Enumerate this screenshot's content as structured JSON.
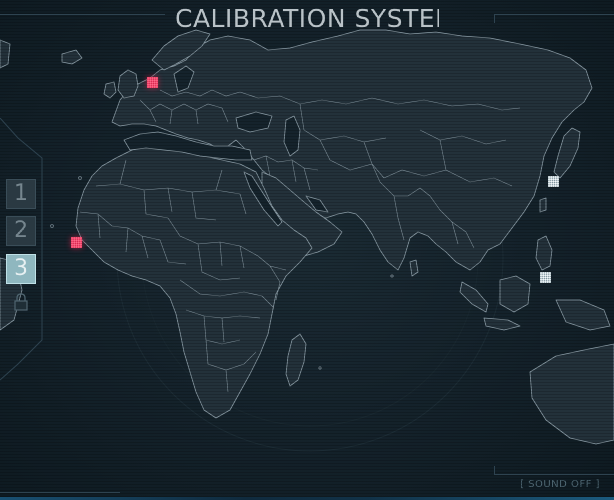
{
  "title": "CALIBRATION SYSTEM",
  "levels": [
    {
      "label": "1",
      "state": "inactive"
    },
    {
      "label": "2",
      "state": "inactive"
    },
    {
      "label": "3",
      "state": "selected"
    }
  ],
  "sound_toggle": "[ SOUND OFF ]",
  "colors": {
    "background": "#15232c",
    "land": "#23313a",
    "borders": "#8a9ba5",
    "title": "#e6eef2",
    "marker_red": "#d7224a",
    "marker_white": "#f2f8fa",
    "selected_button": "#8fb7bf"
  },
  "icons": {
    "lock": "lock-icon"
  }
}
